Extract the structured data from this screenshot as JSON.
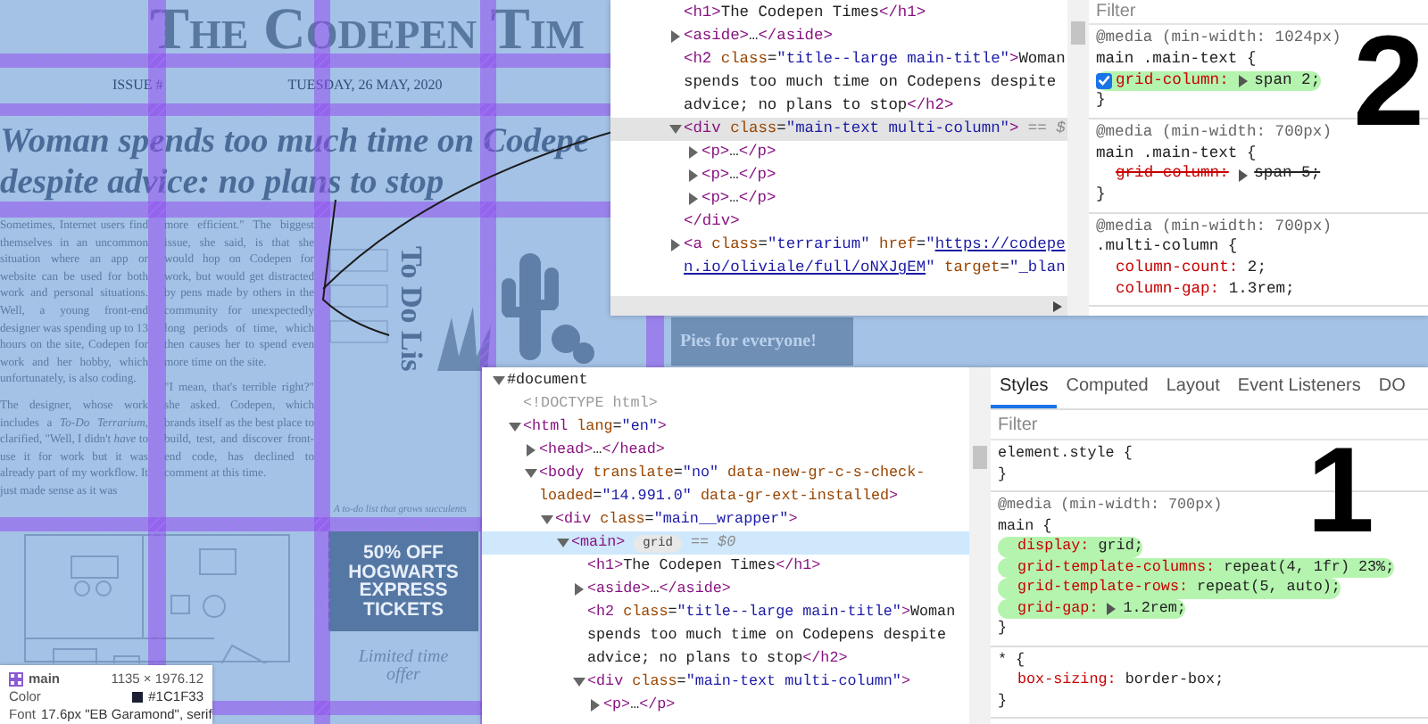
{
  "newspaper": {
    "title": "The Codepen Tim",
    "issue": "ISSUE #",
    "date": "TUESDAY, 26 MAY, 2020",
    "headline": [
      "Woman spends too much time on Codepe",
      "despite advice: no plans to stop"
    ],
    "body_columns": [
      [
        "Sometimes, Internet users find themselves in an uncommon situation where an app or website can be used for both work and personal situations. Well, a young front-end designer was spending up to 13 hours on the site, Codepen for work and her hobby, which unfortunately, is also coding.",
        "The designer, whose work includes a *To-Do Terrarium*, clarified, \"Well, I didn't *have* to use it for work but it was already part of my workflow. It just made sense as it was"
      ],
      [
        "more efficient.\" The biggest issue, she said, is that she would hop on Codepen for work, but would get distracted by pens made by others in the community for unexpectedly long periods of time, which then causes her to spend even more time on the site.",
        "\"I mean, that's terrible right?\" she asked. Codepen, which brands itself as the best place to build, test, and discover front-end code, has declined to comment at this time."
      ]
    ],
    "feature_title": "To Do Lis",
    "feature_caption": "A to-do list that grows succulents",
    "side_story": "Pies for everyone!",
    "ad": {
      "text": "50% OFF HOGWARTS EXPRESS TICKETS",
      "subtext": "Limited time offer"
    }
  },
  "inspect_tooltip": {
    "element": "main",
    "size": "1135 × 1976.12",
    "rows": [
      {
        "kind": "color",
        "label": "Color",
        "value": "#1C1F33"
      },
      {
        "kind": "plain",
        "label": "Font",
        "value": "17.6px \"EB Garamond\", serif"
      }
    ]
  },
  "top_panel": {
    "focused": false,
    "annotation": "2",
    "dom_tree": [
      {
        "lines": [
          [
            {
              "kind": "tag",
              "text": "<h1>"
            },
            {
              "kind": "text",
              "text": "The Codepen Times"
            },
            {
              "kind": "tag",
              "text": "</h1>"
            }
          ]
        ]
      },
      {
        "expanded": false,
        "lines": [
          [
            {
              "kind": "tag",
              "text": "<aside>"
            },
            {
              "kind": "text",
              "text": "…"
            },
            {
              "kind": "tag",
              "text": "</aside>"
            }
          ]
        ]
      },
      {
        "lines": [
          [
            {
              "kind": "tag",
              "text": "<h2 "
            },
            {
              "kind": "attr",
              "text": "class"
            },
            {
              "kind": "text",
              "text": "="
            },
            {
              "kind": "value",
              "text": "\"title--large main-title\""
            },
            {
              "kind": "tag",
              "text": ">"
            },
            {
              "kind": "text",
              "text": "Woman"
            }
          ],
          [
            {
              "kind": "text",
              "text": "spends too much time on Codepens despite"
            }
          ],
          [
            {
              "kind": "text",
              "text": "advice; no plans to stop"
            },
            {
              "kind": "tag",
              "text": "</h2>"
            }
          ]
        ]
      },
      {
        "expanded": true,
        "selected": true,
        "lines": [
          [
            {
              "kind": "tag",
              "text": "<div "
            },
            {
              "kind": "attr",
              "text": "class"
            },
            {
              "kind": "text",
              "text": "="
            },
            {
              "kind": "value",
              "text": "\"main-text multi-column\""
            },
            {
              "kind": "tag",
              "text": ">"
            },
            {
              "kind": "marker",
              "text": " == $"
            }
          ]
        ],
        "children": [
          {
            "expanded": false,
            "lines": [
              [
                {
                  "kind": "tag",
                  "text": "<p>"
                },
                {
                  "kind": "text",
                  "text": "…"
                },
                {
                  "kind": "tag",
                  "text": "</p>"
                }
              ]
            ]
          },
          {
            "expanded": false,
            "lines": [
              [
                {
                  "kind": "tag",
                  "text": "<p>"
                },
                {
                  "kind": "text",
                  "text": "…"
                },
                {
                  "kind": "tag",
                  "text": "</p>"
                }
              ]
            ]
          },
          {
            "expanded": false,
            "lines": [
              [
                {
                  "kind": "tag",
                  "text": "<p>"
                },
                {
                  "kind": "text",
                  "text": "…"
                },
                {
                  "kind": "tag",
                  "text": "</p>"
                }
              ]
            ]
          }
        ],
        "end_tag": "</div>"
      },
      {
        "expanded": false,
        "lines": [
          [
            {
              "kind": "tag",
              "text": "<a "
            },
            {
              "kind": "attr",
              "text": "class"
            },
            {
              "kind": "text",
              "text": "="
            },
            {
              "kind": "value",
              "text": "\"terrarium\""
            },
            {
              "kind": "attr",
              "text": " href"
            },
            {
              "kind": "text",
              "text": "="
            },
            {
              "kind": "value",
              "text": "\""
            },
            {
              "kind": "link",
              "text": "https://codepe"
            }
          ],
          [
            {
              "kind": "link",
              "text": "n.io/oliviale/full/oNXJgEM"
            },
            {
              "kind": "value",
              "text": "\""
            },
            {
              "kind": "attr",
              "text": " target"
            },
            {
              "kind": "text",
              "text": "="
            },
            {
              "kind": "value",
              "text": "\"_blan"
            }
          ]
        ]
      }
    ],
    "styles": {
      "filter_placeholder": "Filter",
      "rules": [
        {
          "header": [
            "@media (min-width: 1024px)",
            "main .main-text {"
          ],
          "declarations": [
            {
              "property": "grid-column:",
              "value": "span 2;",
              "expandable": true,
              "hovered": true,
              "overridden": false,
              "highlighted": true
            }
          ],
          "footer": "}"
        },
        {
          "header": [
            "@media (min-width: 700px)",
            "main .main-text {"
          ],
          "declarations": [
            {
              "property": "grid-column:",
              "value": "span 5;",
              "expandable": true,
              "hovered": false,
              "overridden": true,
              "highlighted": false
            }
          ],
          "footer": "}"
        },
        {
          "header": [
            "@media (min-width: 700px)",
            ".multi-column {"
          ],
          "declarations": [
            {
              "property": "column-count:",
              "value": "2;",
              "expandable": false,
              "hovered": false,
              "overridden": false,
              "highlighted": false
            },
            {
              "property": "column-gap:",
              "value": "1.3rem;",
              "expandable": false,
              "hovered": false,
              "overridden": false,
              "highlighted": false
            }
          ]
        }
      ]
    }
  },
  "bottom_panel": {
    "focused": true,
    "annotation": "1",
    "dom_tree": [
      {
        "expanded": true,
        "lines": [
          [
            {
              "kind": "text",
              "text": "#document"
            }
          ]
        ],
        "children": [
          {
            "lines": [
              [
                {
                  "kind": "comment",
                  "text": "<!DOCTYPE html>"
                }
              ]
            ]
          },
          {
            "expanded": true,
            "lines": [
              [
                {
                  "kind": "tag",
                  "text": "<html "
                },
                {
                  "kind": "attr",
                  "text": "lang"
                },
                {
                  "kind": "text",
                  "text": "="
                },
                {
                  "kind": "value",
                  "text": "\"en\""
                },
                {
                  "kind": "tag",
                  "text": ">"
                }
              ]
            ],
            "children": [
              {
                "expanded": false,
                "lines": [
                  [
                    {
                      "kind": "tag",
                      "text": "<head>"
                    },
                    {
                      "kind": "text",
                      "text": "…"
                    },
                    {
                      "kind": "tag",
                      "text": "</head>"
                    }
                  ]
                ]
              },
              {
                "expanded": true,
                "lines": [
                  [
                    {
                      "kind": "tag",
                      "text": "<body "
                    },
                    {
                      "kind": "attr",
                      "text": "translate"
                    },
                    {
                      "kind": "text",
                      "text": "="
                    },
                    {
                      "kind": "value",
                      "text": "\"no\""
                    },
                    {
                      "kind": "attr",
                      "text": " data-new-gr-c-s-check-"
                    }
                  ],
                  [
                    {
                      "kind": "attr",
                      "text": "loaded"
                    },
                    {
                      "kind": "text",
                      "text": "="
                    },
                    {
                      "kind": "value",
                      "text": "\"14.991.0\""
                    },
                    {
                      "kind": "attr",
                      "text": " data-gr-ext-installed"
                    },
                    {
                      "kind": "tag",
                      "text": ">"
                    }
                  ]
                ],
                "children": [
                  {
                    "expanded": true,
                    "lines": [
                      [
                        {
                          "kind": "tag",
                          "text": "<div "
                        },
                        {
                          "kind": "attr",
                          "text": "class"
                        },
                        {
                          "kind": "text",
                          "text": "="
                        },
                        {
                          "kind": "value",
                          "text": "\"main__wrapper\""
                        },
                        {
                          "kind": "tag",
                          "text": ">"
                        }
                      ]
                    ],
                    "children": [
                      {
                        "expanded": true,
                        "selected": true,
                        "lines": [
                          [
                            {
                              "kind": "tag",
                              "text": "<main>"
                            },
                            {
                              "kind": "badge",
                              "text": "grid"
                            },
                            {
                              "kind": "marker",
                              "text": "== $0"
                            }
                          ]
                        ],
                        "children": [
                          {
                            "lines": [
                              [
                                {
                                  "kind": "tag",
                                  "text": "<h1>"
                                },
                                {
                                  "kind": "text",
                                  "text": "The Codepen Times"
                                },
                                {
                                  "kind": "tag",
                                  "text": "</h1>"
                                }
                              ]
                            ]
                          },
                          {
                            "expanded": false,
                            "lines": [
                              [
                                {
                                  "kind": "tag",
                                  "text": "<aside>"
                                },
                                {
                                  "kind": "text",
                                  "text": "…"
                                },
                                {
                                  "kind": "tag",
                                  "text": "</aside>"
                                }
                              ]
                            ]
                          },
                          {
                            "lines": [
                              [
                                {
                                  "kind": "tag",
                                  "text": "<h2 "
                                },
                                {
                                  "kind": "attr",
                                  "text": "class"
                                },
                                {
                                  "kind": "text",
                                  "text": "="
                                },
                                {
                                  "kind": "value",
                                  "text": "\"title--large main-title\""
                                },
                                {
                                  "kind": "tag",
                                  "text": ">"
                                },
                                {
                                  "kind": "text",
                                  "text": "Woman"
                                }
                              ],
                              [
                                {
                                  "kind": "text",
                                  "text": "spends too much time on Codepens despite"
                                }
                              ],
                              [
                                {
                                  "kind": "text",
                                  "text": "advice; no plans to stop"
                                },
                                {
                                  "kind": "tag",
                                  "text": "</h2>"
                                }
                              ]
                            ]
                          },
                          {
                            "expanded": true,
                            "lines": [
                              [
                                {
                                  "kind": "tag",
                                  "text": "<div "
                                },
                                {
                                  "kind": "attr",
                                  "text": "class"
                                },
                                {
                                  "kind": "text",
                                  "text": "="
                                },
                                {
                                  "kind": "value",
                                  "text": "\"main-text multi-column\""
                                },
                                {
                                  "kind": "tag",
                                  "text": ">"
                                }
                              ]
                            ],
                            "children": [
                              {
                                "expanded": false,
                                "lines": [
                                  [
                                    {
                                      "kind": "tag",
                                      "text": "<p>"
                                    },
                                    {
                                      "kind": "text",
                                      "text": "…"
                                    },
                                    {
                                      "kind": "tag",
                                      "text": "</p>"
                                    }
                                  ]
                                ]
                              }
                            ]
                          }
                        ]
                      }
                    ]
                  }
                ]
              }
            ]
          }
        ]
      }
    ],
    "styles": {
      "tabs": [
        {
          "label": "Styles",
          "selected": true
        },
        {
          "label": "Computed",
          "selected": false
        },
        {
          "label": "Layout",
          "selected": false
        },
        {
          "label": "Event Listeners",
          "selected": false
        },
        {
          "label": "DO",
          "selected": false
        }
      ],
      "filter_placeholder": "Filter",
      "rules": [
        {
          "header": [
            "element.style {"
          ],
          "footer": "}"
        },
        {
          "header": [
            "@media (min-width: 700px)",
            "main {"
          ],
          "declarations": [
            {
              "property": "display:",
              "value": "grid;",
              "expandable": false,
              "hovered": false,
              "overridden": false,
              "highlighted": true
            },
            {
              "property": "grid-template-columns:",
              "value": "repeat(4, 1fr) 23%;",
              "expandable": false,
              "hovered": false,
              "overridden": false,
              "highlighted": true
            },
            {
              "property": "grid-template-rows:",
              "value": "repeat(5, auto);",
              "expandable": false,
              "hovered": false,
              "overridden": false,
              "highlighted": true
            },
            {
              "property": "grid-gap:",
              "value": "1.2rem;",
              "expandable": true,
              "hovered": false,
              "overridden": false,
              "highlighted": true
            }
          ],
          "footer": "}"
        },
        {
          "header": [
            "* {"
          ],
          "declarations": [
            {
              "property": "box-sizing:",
              "value": "border-box;",
              "expandable": false,
              "hovered": false,
              "overridden": false,
              "highlighted": false
            }
          ],
          "footer": "}"
        }
      ]
    }
  }
}
